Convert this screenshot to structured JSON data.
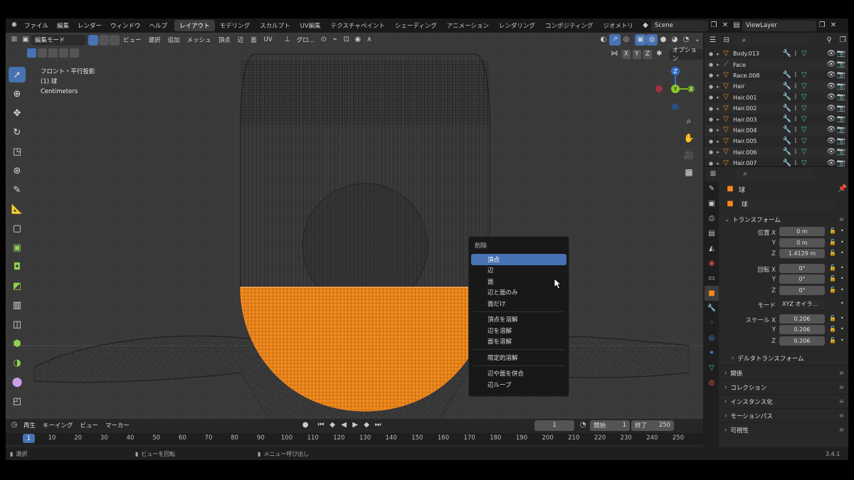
{
  "topbar": {
    "menus": [
      "ファイル",
      "編集",
      "レンダー",
      "ウィンドウ",
      "ヘルプ"
    ],
    "workspaces": [
      "レイアウト",
      "モデリング",
      "スカルプト",
      "UV編集",
      "テクスチャペイント",
      "シェーディング",
      "アニメーション",
      "レンダリング",
      "コンポジティング",
      "ジオメトリ"
    ],
    "active_workspace": "レイアウト",
    "scene": "Scene",
    "view_layer": "ViewLayer"
  },
  "viewport": {
    "mode": "編集モード",
    "menus": [
      "ビュー",
      "選択",
      "追加",
      "メッシュ",
      "頂点",
      "辺",
      "面",
      "UV"
    ],
    "orientation": "グロ...",
    "xyz": [
      "X",
      "Y",
      "Z"
    ],
    "options": "オプション",
    "view_name": "フロント・平行投影",
    "object_label": "(1) 球",
    "units": "Centimeters",
    "gizmo": {
      "x": "X",
      "y": "Y",
      "z": "Z"
    }
  },
  "context_menu": {
    "title": "削除",
    "items": [
      "頂点",
      "辺",
      "面",
      "辺と面のみ",
      "面だけ",
      "頂点を溶解",
      "辺を溶解",
      "面を溶解",
      "限定的溶解",
      "辺や面を併合",
      "辺ループ"
    ],
    "highlighted": "頂点"
  },
  "timeline": {
    "menus": [
      "再生",
      "キーイング",
      "ビュー",
      "マーカー"
    ],
    "current_frame": "1",
    "start_label": "開始",
    "start": "1",
    "end_label": "終了",
    "end": "250",
    "ruler": [
      "1",
      "10",
      "20",
      "30",
      "40",
      "50",
      "60",
      "70",
      "80",
      "90",
      "100",
      "110",
      "120",
      "130",
      "140",
      "150",
      "160",
      "170",
      "180",
      "190",
      "200",
      "210",
      "220",
      "230",
      "240",
      "250"
    ]
  },
  "status": {
    "select": "選択",
    "rotate": "ビューを回転",
    "menu": "メニュー呼び出し",
    "version": "3.4.1"
  },
  "outliner": {
    "items": [
      "Body.013",
      "Face",
      "Race.008",
      "Hair",
      "Hair.001",
      "Hair.002",
      "Hair.003",
      "Hair.004",
      "Hair.005",
      "Hair.006",
      "Hair.007"
    ]
  },
  "properties": {
    "object_name": "球",
    "object_field": "球",
    "transform_label": "トランスフォーム",
    "location_label": "位置 X",
    "rotation_label": "回転 X",
    "scale_label": "スケール X",
    "axis_y": "Y",
    "axis_z": "Z",
    "location": [
      "0 m",
      "0 m",
      "1.4129 m"
    ],
    "rotation": [
      "0°",
      "0°",
      "0°"
    ],
    "mode_label": "モード",
    "mode": "XYZ オイラ...",
    "scale": [
      "0.206",
      "0.206",
      "0.206"
    ],
    "sections": [
      "デルタトランスフォーム",
      "関係",
      "コレクション",
      "インスタンス化",
      "モーションパス",
      "可視性"
    ]
  },
  "colors": {
    "accent": "#4772b3",
    "selection": "#f5871f",
    "viewport_bg": "#393939"
  }
}
